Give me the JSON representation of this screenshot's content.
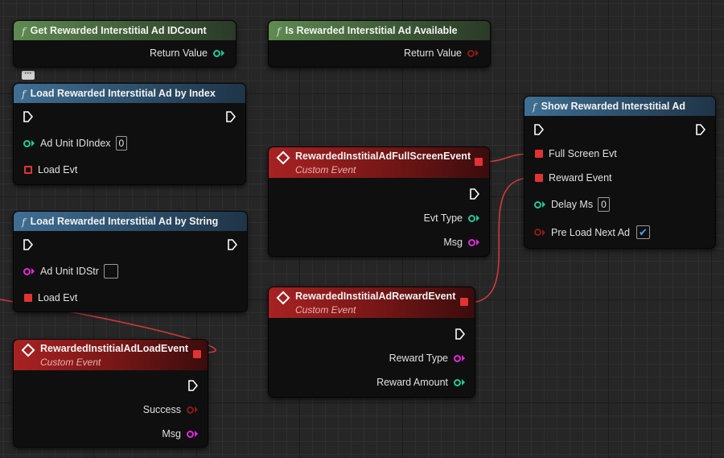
{
  "nodes": {
    "get_count": {
      "title": "Get Rewarded Interstitial Ad IDCount",
      "return_label": "Return Value"
    },
    "is_available": {
      "title": "Is Rewarded Interstitial Ad Available",
      "return_label": "Return Value"
    },
    "load_by_index": {
      "title": "Load Rewarded Interstitial Ad by Index",
      "param_label": "Ad Unit IDIndex",
      "param_value": "0",
      "evt_label": "Load Evt"
    },
    "load_by_string": {
      "title": "Load Rewarded Interstitial Ad by String",
      "param_label": "Ad Unit IDStr",
      "param_value": "",
      "evt_label": "Load Evt"
    },
    "load_event": {
      "title": "RewardedInstitialAdLoadEvent",
      "subtitle": "Custom Event",
      "out1": "Success",
      "out2": "Msg"
    },
    "fullscreen_event": {
      "title": "RewardedInstitialAdFullScreenEvent",
      "subtitle": "Custom Event",
      "out1": "Evt Type",
      "out2": "Msg"
    },
    "reward_event": {
      "title": "RewardedInstitialAdRewardEvent",
      "subtitle": "Custom Event",
      "out1": "Reward Type",
      "out2": "Reward Amount"
    },
    "show_ad": {
      "title": "Show Rewarded Interstitial Ad",
      "full_screen_label": "Full Screen Evt",
      "reward_label": "Reward Event",
      "delay_label": "Delay Ms",
      "delay_value": "0",
      "preload_label": "Pre Load Next Ad",
      "preload_checked": true
    }
  },
  "comment_icon": "speech-bubble-icon",
  "colors": {
    "wire": "#d33a3a",
    "exec": "#ffffff",
    "int_pin": "#22c99a",
    "string_pin": "#e02ad8",
    "bool_pin": "#8a1a1a",
    "delegate_pin": "#e03333",
    "checkbox": "#4aa0ff"
  }
}
